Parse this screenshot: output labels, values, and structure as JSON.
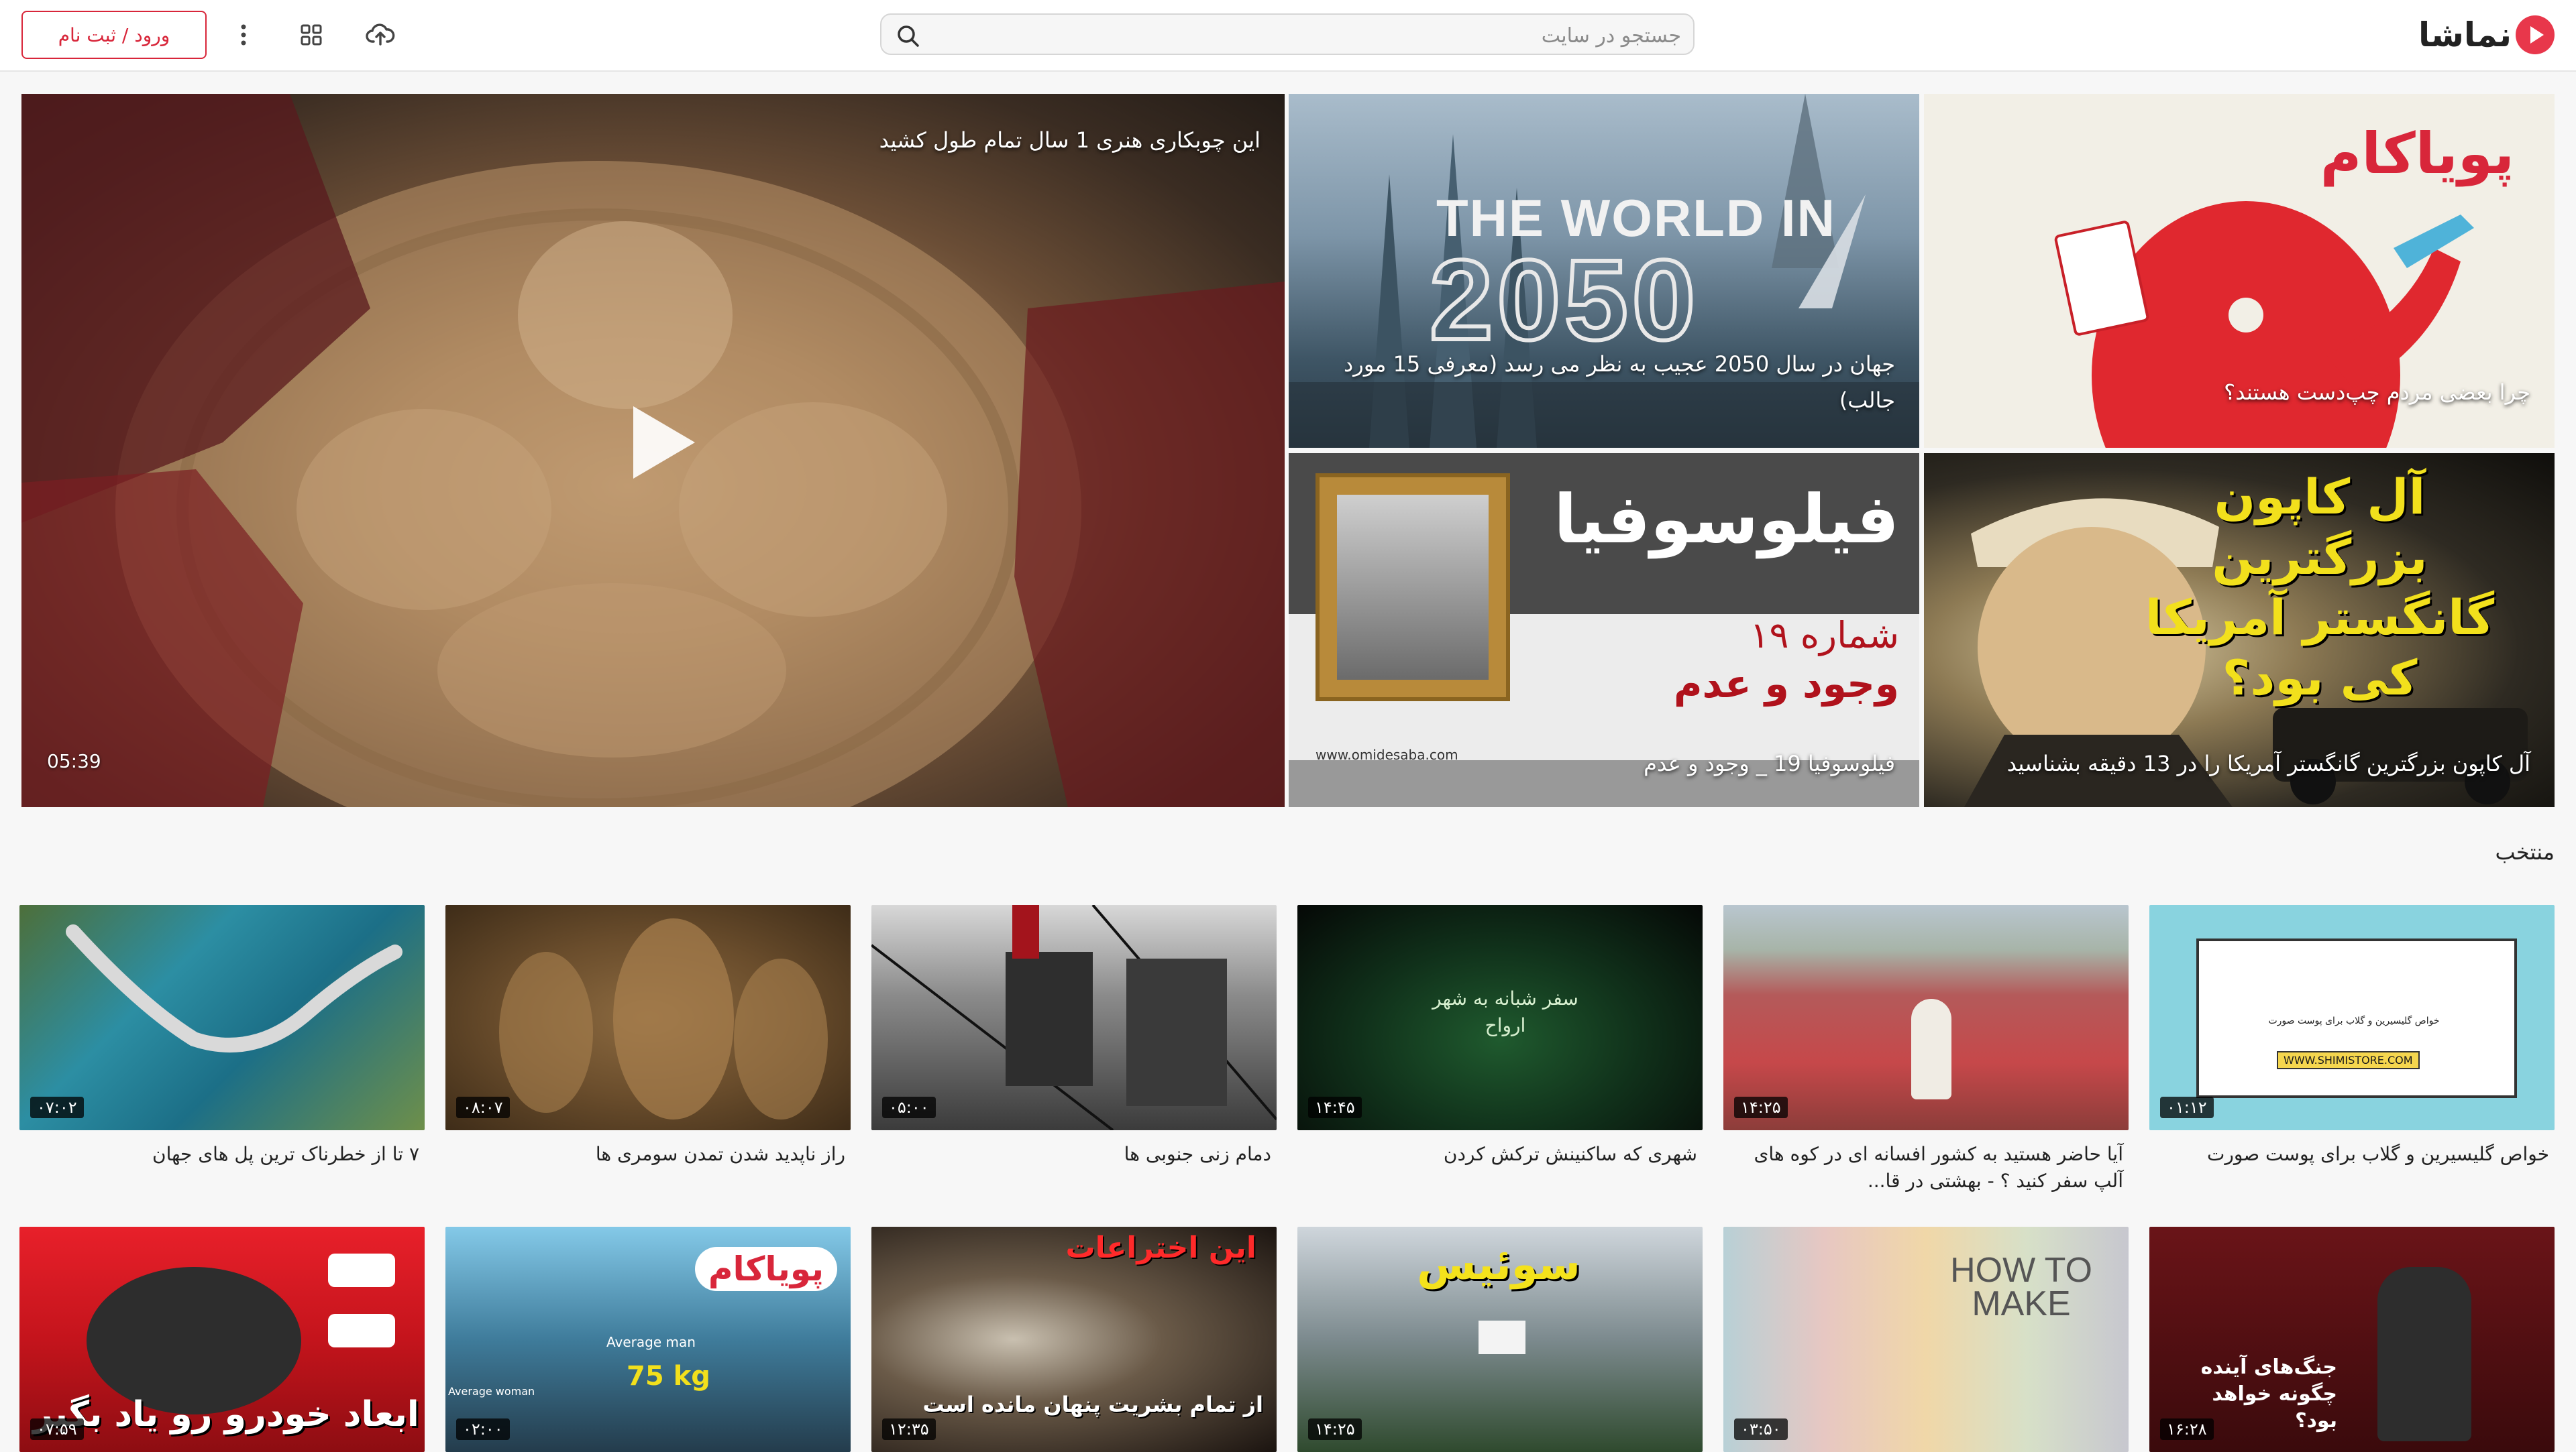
{
  "header": {
    "logo_text": "نماشا",
    "search_placeholder": "جستجو در سایت",
    "login_label": "ورود / ثبت نام",
    "icons": [
      "upload-icon",
      "apps-grid-icon",
      "more-vert-icon",
      "search-icon"
    ]
  },
  "hero": {
    "main": {
      "title": "این چوبکاری هنری 1 سال تمام طول کشید",
      "duration": "05:39"
    },
    "tiles": [
      {
        "title": "جهان در سال 2050 عجیب به نظر می رسد (معرفی 15 مورد جالب)",
        "overlay_line1": "THE WORLD IN",
        "overlay_line2": "2050"
      },
      {
        "title": "چرا بعضی مردم چپ‌دست هستند؟",
        "overlay": "پویاکام"
      },
      {
        "title": "فیلوسوفیا 19 _ وجود و عدم",
        "overlay_title": "فیلوسوفیا",
        "overlay_sub1": "شماره ۱۹",
        "overlay_sub2": "وجود و عدم",
        "overlay_url": "www.omidesaba.com"
      },
      {
        "title": "آل کاپون بزرگترین گانگستر آمریکا را در 13 دقیقه بشناسید",
        "overlay": "آل کاپون بزرگترین گانگستر آمریکا کی بود؟"
      }
    ]
  },
  "section": {
    "title": "منتخب",
    "row1": [
      {
        "title": "خواص گلیسیرین و گلاب برای پوست صورت",
        "duration": "۰۱:۱۲",
        "thumb_text1": "خواص گلیسیرین و گلاب برای پوست صورت",
        "thumb_text2": "WWW.SHIMISTORE.COM"
      },
      {
        "title": "آیا حاضر هستید به کشور افسانه ای در کوه های آلپ سفر کنید ؟ - بهشتی در قا...",
        "duration": "۱۴:۲۵"
      },
      {
        "title": "شهری که ساکنینش ترکش کردن",
        "duration": "۱۴:۴۵",
        "thumb_text": "سفر شبانه به شهر ارواح"
      },
      {
        "title": "دمام زنی جنوبی ها",
        "duration": "۰۵:۰۰"
      },
      {
        "title": "راز ناپدید شدن تمدن سومری ها",
        "duration": "۰۸:۰۷"
      },
      {
        "title": "۷ تا از خطرناک ترین پل های جهان",
        "duration": "۰۷:۰۲"
      }
    ],
    "row2": [
      {
        "duration": "۱۶:۲۸",
        "thumb_text": "جنگ‌های آینده چگونه خواهد بود؟"
      },
      {
        "duration": "۰۳:۵۰",
        "thumb_text": "HOW TO MAKE"
      },
      {
        "duration": "۱۴:۲۵",
        "thumb_text": "سوئیس"
      },
      {
        "duration": "۱۲:۳۵",
        "thumb_text1": "این اختراعات",
        "thumb_text2": "از تمام بشریت پنهان مانده است"
      },
      {
        "duration": "۰۲:۰۰",
        "thumb_text1": "پویاکام",
        "thumb_text2": "Average man",
        "thumb_text3": "75 kg",
        "thumb_text4": "Average woman"
      },
      {
        "duration": "۰۷:۵۹",
        "thumb_text": "ابعاد خودرو رو یاد بگیر"
      }
    ]
  },
  "colors": {
    "accent": "#e8374b",
    "login": "#d8263a"
  }
}
